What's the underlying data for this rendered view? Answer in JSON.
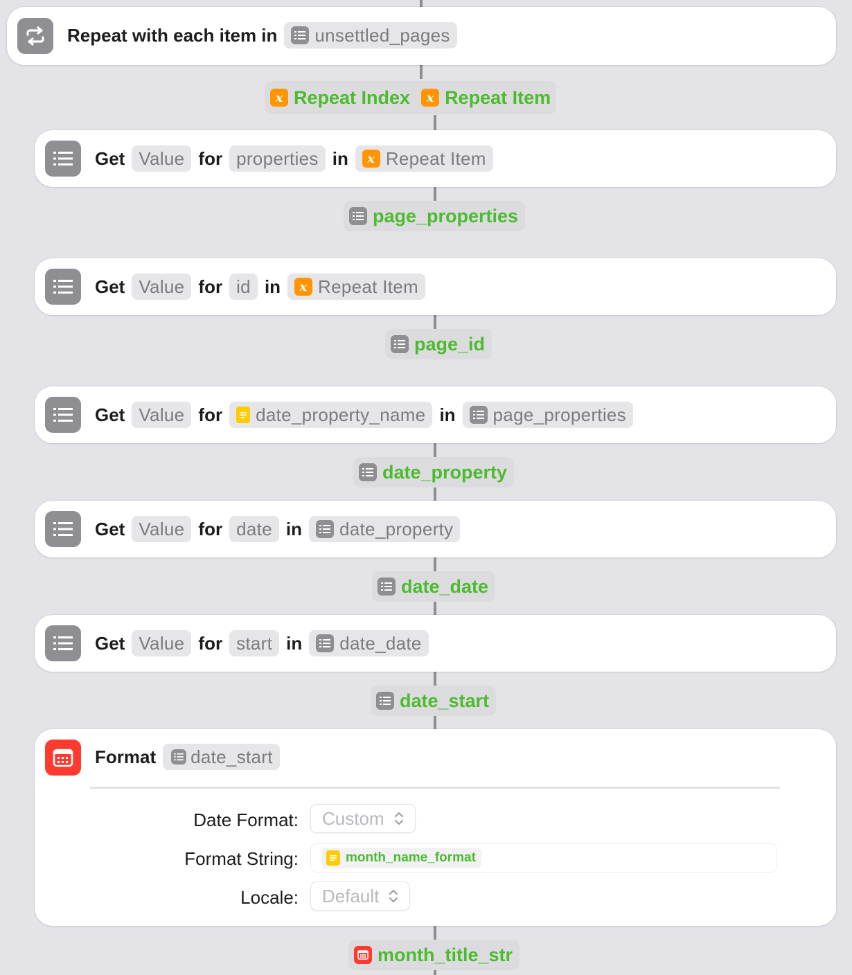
{
  "repeat_block": {
    "label": "Repeat with each item in",
    "variable": "unsettled_pages",
    "outputs": [
      "Repeat Index",
      "Repeat Item"
    ]
  },
  "get_keyword": "Get",
  "value_token": "Value",
  "for_keyword": "for",
  "in_keyword": "in",
  "actions": [
    {
      "key": "properties",
      "key_kind": "plain",
      "source": "Repeat Item",
      "source_kind": "variable",
      "output": "page_properties"
    },
    {
      "key": "id",
      "key_kind": "plain",
      "source": "Repeat Item",
      "source_kind": "variable",
      "output": "page_id"
    },
    {
      "key": "date_property_name",
      "key_kind": "text",
      "source": "page_properties",
      "source_kind": "dictionary",
      "output": "date_property"
    },
    {
      "key": "date",
      "key_kind": "plain",
      "source": "date_property",
      "source_kind": "dictionary",
      "output": "date_date"
    },
    {
      "key": "start",
      "key_kind": "plain",
      "source": "date_date",
      "source_kind": "dictionary",
      "output": "date_start"
    }
  ],
  "format_block": {
    "label": "Format",
    "input": "date_start",
    "fields": [
      {
        "label": "Date Format:",
        "value": "Custom"
      },
      {
        "label": "Format String:",
        "value": "month_name_format"
      },
      {
        "label": "Locale:",
        "value": "Default"
      }
    ],
    "output": "month_title_str"
  },
  "colors": {
    "background": "#e4e3e8",
    "variable_green": "#4cbb2f",
    "dictionary_gray": "#8e8e93",
    "variable_orange": "#ff9500",
    "text_yellow": "#ffcc00",
    "calendar_red": "#ff3b30"
  },
  "icons": {
    "repeat": "repeat-icon",
    "dictionary": "list-icon",
    "variable": "x-variable-icon",
    "text": "text-icon",
    "calendar": "calendar-icon",
    "popup": "chevron-up-down-icon"
  }
}
